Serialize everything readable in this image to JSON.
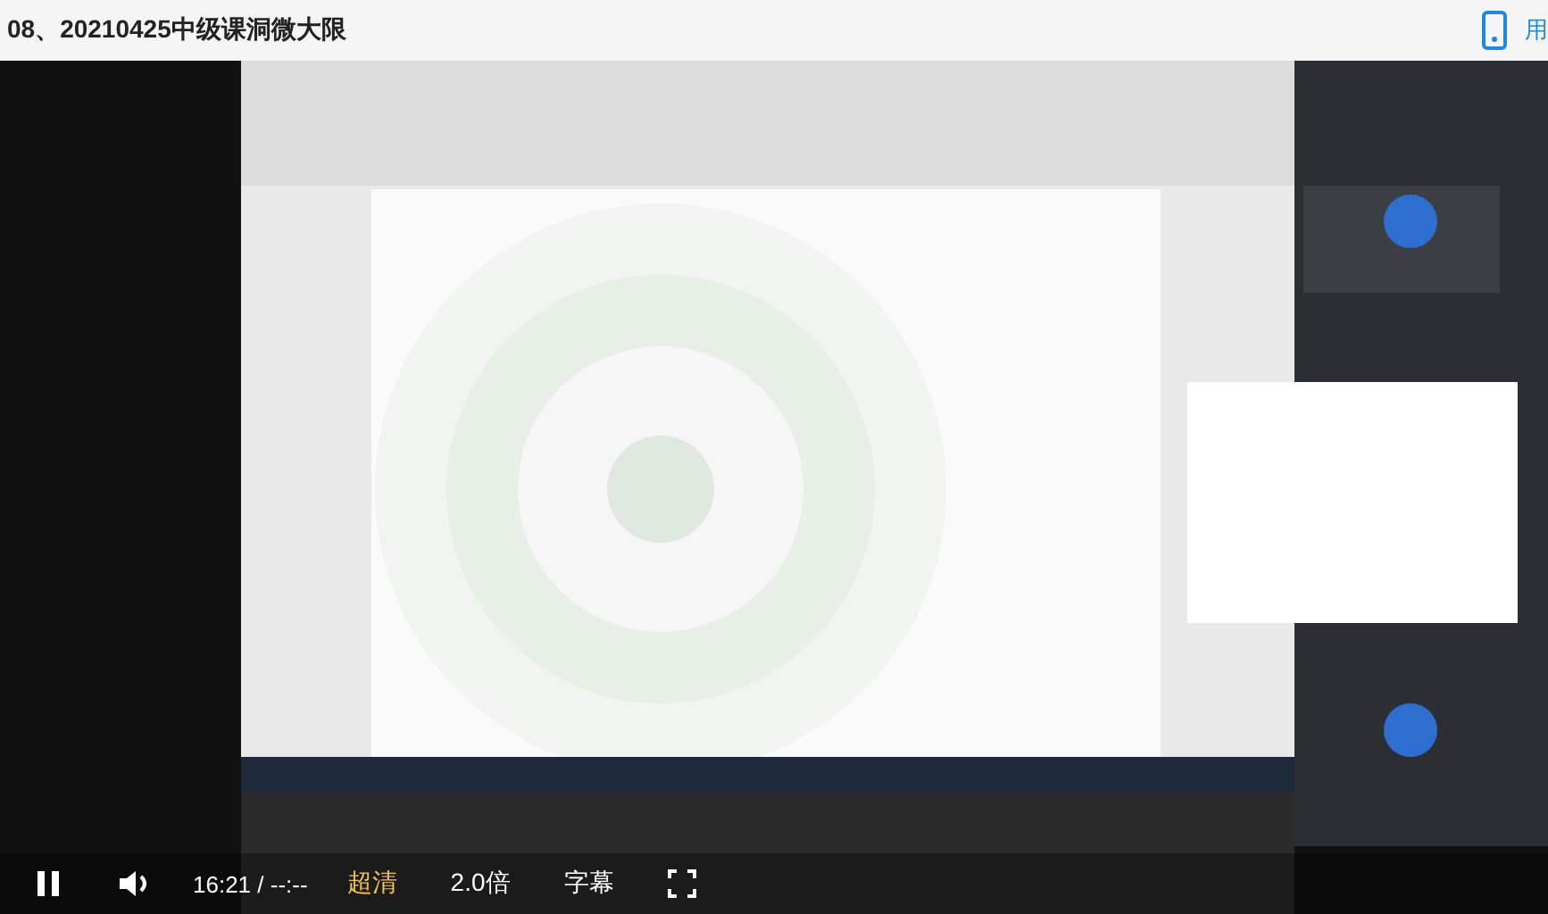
{
  "title": "08、20210425中级课洞微大限",
  "header_link": "用",
  "controls": {
    "playing": true,
    "time": "16:21 / --:--",
    "quality": "超清",
    "speed": "2.0倍",
    "subtitles": "字幕"
  }
}
